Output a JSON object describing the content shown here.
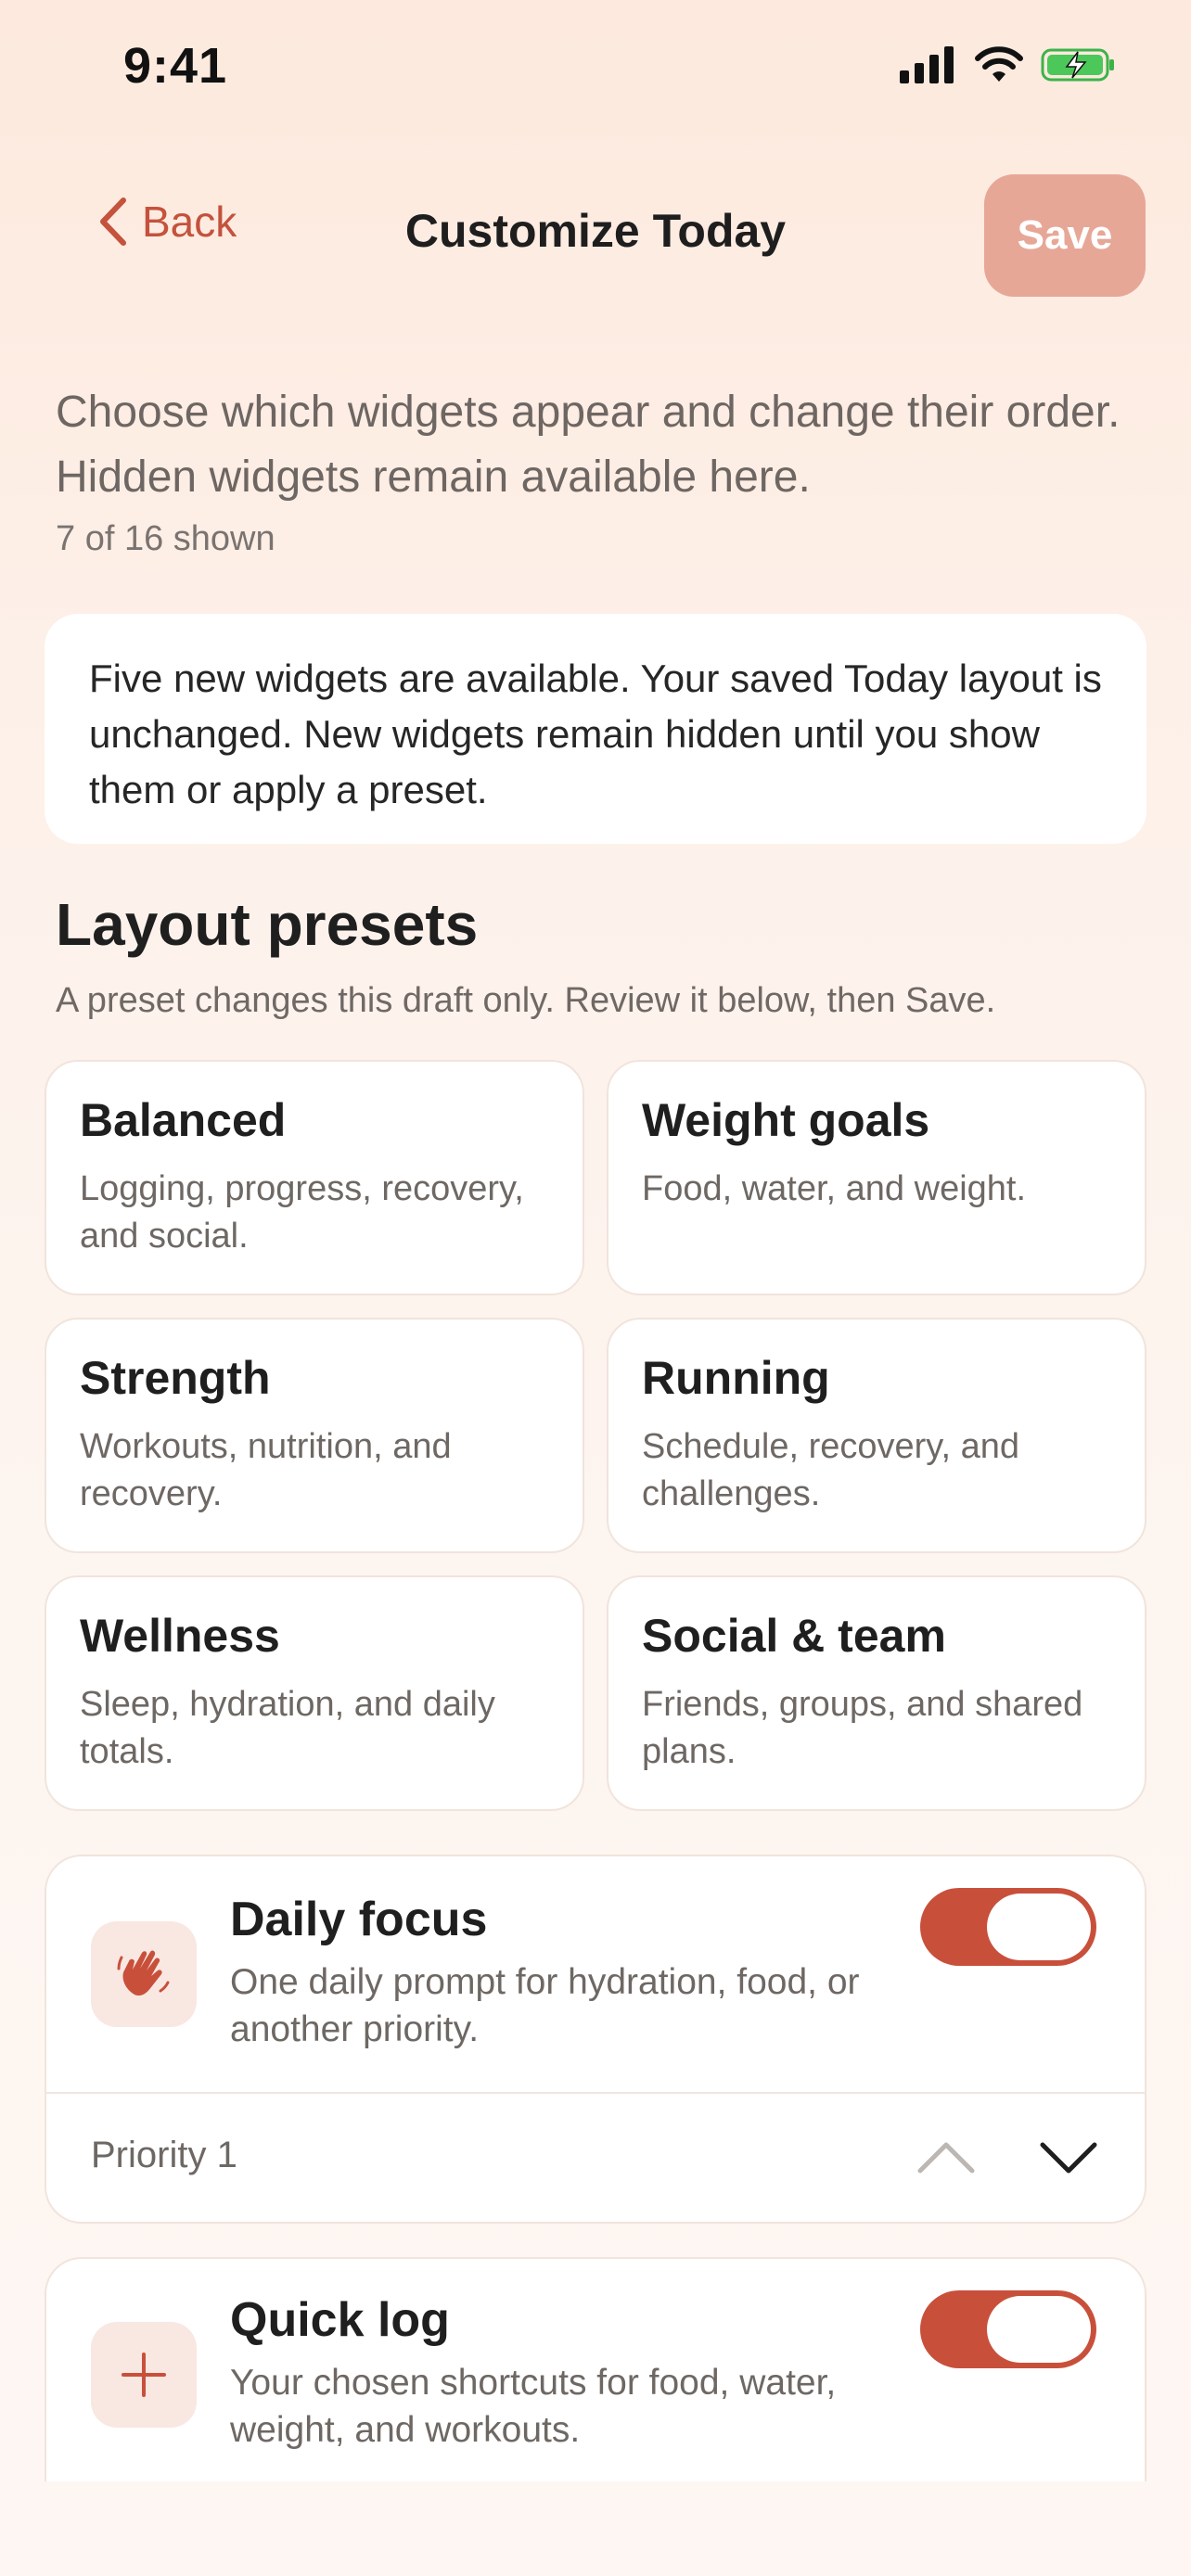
{
  "status_bar": {
    "time": "9:41"
  },
  "nav": {
    "back_label": "Back",
    "title": "Customize Today",
    "save_label": "Save"
  },
  "intro": {
    "text": "Choose which widgets appear and change their order. Hidden widgets remain available here.",
    "count": "7 of 16 shown"
  },
  "notice": {
    "text": "Five new widgets are available. Your saved Today layout is unchanged. New widgets remain hidden until you show them or apply a preset."
  },
  "presets": {
    "title": "Layout presets",
    "subtitle": "A preset changes this draft only. Review it below, then Save.",
    "items": [
      {
        "name": "Balanced",
        "desc": "Logging, progress, recovery, and social."
      },
      {
        "name": "Weight goals",
        "desc": "Food, water, and weight."
      },
      {
        "name": "Strength",
        "desc": "Workouts, nutrition, and recovery."
      },
      {
        "name": "Running",
        "desc": "Schedule, recovery, and challenges."
      },
      {
        "name": "Wellness",
        "desc": "Sleep, hydration, and daily totals."
      },
      {
        "name": "Social & team",
        "desc": "Friends, groups, and shared plans."
      }
    ]
  },
  "widgets": [
    {
      "title": "Daily focus",
      "desc": "One daily prompt for hydration, food, or another priority.",
      "icon": "hand-wave-icon",
      "enabled": true,
      "priority": "Priority 1"
    },
    {
      "title": "Quick log",
      "desc": "Your chosen shortcuts for food, water, weight, and workouts.",
      "icon": "plus-icon",
      "enabled": true
    }
  ],
  "colors": {
    "accent": "#c8503b",
    "save_disabled": "#e7a797",
    "icon_bg": "#f9e7e2"
  }
}
